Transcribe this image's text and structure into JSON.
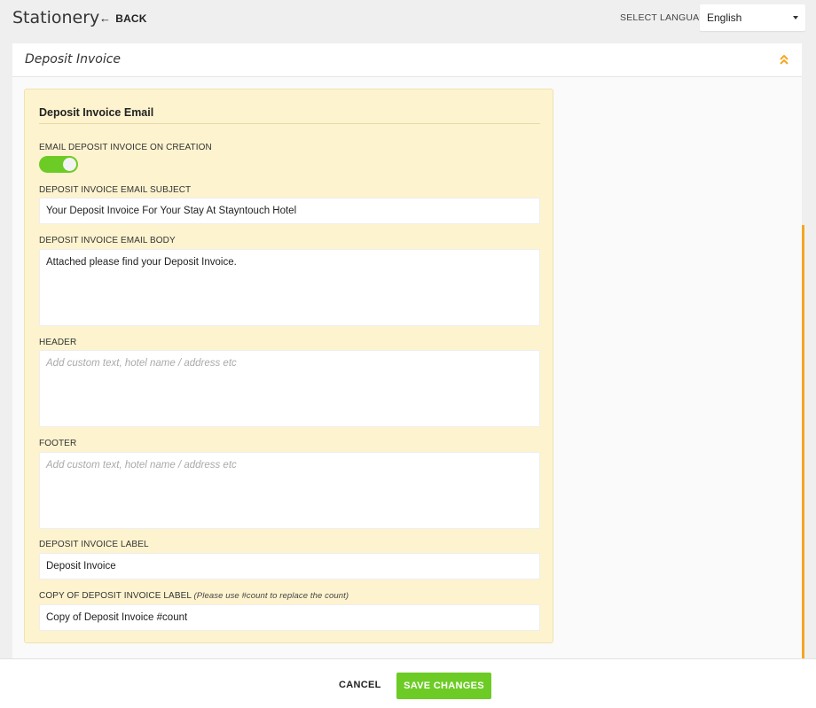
{
  "header": {
    "title": "Stationery",
    "back_label": "BACK",
    "language_label": "SELECT LANGUAGE",
    "language_value": "English"
  },
  "section": {
    "title": "Deposit Invoice"
  },
  "card": {
    "title": "Deposit Invoice Email",
    "toggle": {
      "label": "EMAIL DEPOSIT INVOICE ON CREATION",
      "enabled": true
    },
    "subject": {
      "label": "DEPOSIT INVOICE EMAIL SUBJECT",
      "value": "Your Deposit Invoice For Your Stay At Stayntouch Hotel"
    },
    "body": {
      "label": "DEPOSIT INVOICE EMAIL BODY",
      "value": "Attached please find your Deposit Invoice."
    },
    "header_field": {
      "label": "HEADER",
      "placeholder": "Add custom text, hotel name / address etc"
    },
    "footer_field": {
      "label": "FOOTER",
      "placeholder": "Add custom text, hotel name / address etc"
    },
    "invoice_label": {
      "label": "DEPOSIT INVOICE LABEL",
      "value": "Deposit Invoice"
    },
    "copy_label": {
      "label": "COPY OF DEPOSIT INVOICE LABEL",
      "hint": "(Please use #count to replace the count)",
      "value": "Copy of Deposit Invoice #count"
    }
  },
  "footer": {
    "cancel_label": "CANCEL",
    "save_label": "SAVE CHANGES"
  },
  "colors": {
    "accent_green": "#6dcb25",
    "card_bg": "#fdf3cf",
    "scroll_orange": "#f5a623"
  }
}
